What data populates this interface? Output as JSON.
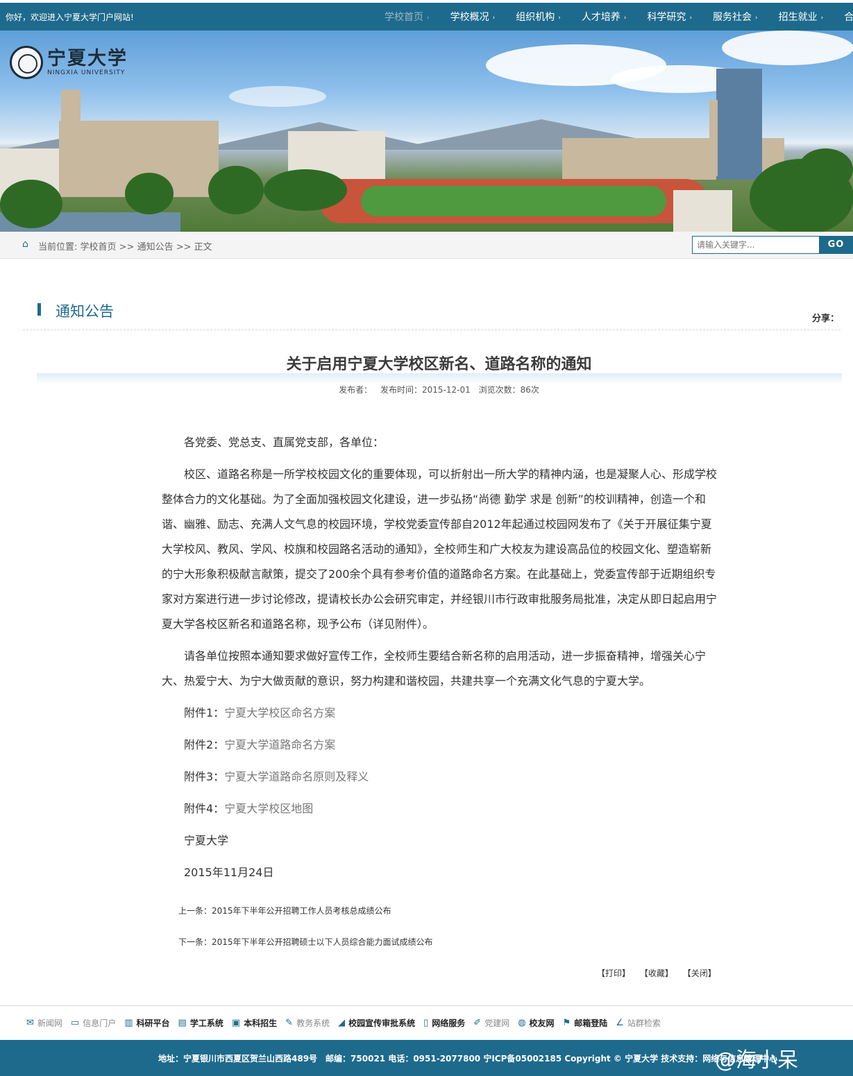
{
  "topbar": {
    "welcome": "你好，欢迎进入宁夏大学门户网站!",
    "nav": [
      {
        "label": "学校首页"
      },
      {
        "label": "学校概况"
      },
      {
        "label": "组织机构"
      },
      {
        "label": "人才培养"
      },
      {
        "label": "科学研究"
      },
      {
        "label": "服务社会"
      },
      {
        "label": "招生就业"
      },
      {
        "label": "合作交流"
      }
    ]
  },
  "logo": {
    "cn": "宁夏大学",
    "en": "NINGXIA UNIVERSITY"
  },
  "breadcrumb": {
    "label": "当前位置:",
    "path": "学校首页 >> 通知公告 >> 正文"
  },
  "search": {
    "placeholder": "请输入关键字...",
    "button": "GO"
  },
  "section": {
    "title": "通知公告",
    "share": "分享："
  },
  "article": {
    "title": "关于启用宁夏大学校区新名、道路名称的通知",
    "meta": {
      "publisher": "发布者：",
      "date": "发布时间：2015-12-01",
      "views": "浏览次数：86次"
    },
    "salutation": "各党委、党总支、直属党支部，各单位：",
    "para1": "校区、道路名称是一所学校校园文化的重要体现，可以折射出一所大学的精神内涵，也是凝聚人心、形成学校整体合力的文化基础。为了全面加强校园文化建设，进一步弘扬“尚德 勤学 求是 创新”的校训精神，创造一个和谐、幽雅、励志、充满人文气息的校园环境，学校党委宣传部自2012年起通过校园网发布了《关于开展征集宁夏大学校风、教风、学风、校旗和校园路名活动的通知》，全校师生和广大校友为建设高品位的校园文化、塑造崭新的宁大形象积极献言献策，提交了200余个具有参考价值的道路命名方案。在此基础上，党委宣传部于近期组织专家对方案进行进一步讨论修改，提请校长办公会研究审定，并经银川市行政审批服务局批准，决定从即日起启用宁夏大学各校区新名和道路名称，现予公布（详见附件）。",
    "para2": "请各单位按照本通知要求做好宣传工作，全校师生要结合新名称的启用活动，进一步振奋精神，增强关心宁大、热爱宁大、为宁大做贡献的意识，努力构建和谐校园，共建共享一个充满文化气息的宁夏大学。",
    "attachments": [
      {
        "prefix": "附件1：",
        "name": "宁夏大学校区命名方案"
      },
      {
        "prefix": "附件2：",
        "name": "宁夏大学道路命名方案"
      },
      {
        "prefix": "附件3：",
        "name": "宁夏大学道路命名原则及释义"
      },
      {
        "prefix": "附件4：",
        "name": "宁夏大学校区地图"
      }
    ],
    "signature": "宁夏大学",
    "sign_date": "2015年11月24日",
    "prev": "上一条：2015年下半年公开招聘工作人员考核总成绩公布",
    "next": "下一条：2015年下半年公开招聘硕士以下人员综合能力面试成绩公布",
    "actions": [
      "【打印】",
      "【收藏】",
      "【关闭】"
    ]
  },
  "footer_links": [
    {
      "icon": "mail-icon",
      "label": "新闻网"
    },
    {
      "icon": "monitor-icon",
      "label": "信息门户"
    },
    {
      "icon": "books-icon",
      "label": "科研平台"
    },
    {
      "icon": "document-icon",
      "label": "学工系统"
    },
    {
      "icon": "screen-user-icon",
      "label": "本科招生"
    },
    {
      "icon": "edit-icon",
      "label": "教务系统"
    },
    {
      "icon": "rss-icon",
      "label": "校园宣传审批系统"
    },
    {
      "icon": "phone-icon",
      "label": "网络服务"
    },
    {
      "icon": "pen-icon",
      "label": "党建网"
    },
    {
      "icon": "globe-icon",
      "label": "校友网"
    },
    {
      "icon": "flag-icon",
      "label": "邮箱登陆"
    },
    {
      "icon": "chart-icon",
      "label": "站群检索"
    }
  ],
  "footer": {
    "address": "地址：宁夏银川市西夏区贺兰山西路489号　邮编：750021 电话：0951-2077800 宁ICP备05002185 Copyright © 宁夏大学 技术支持：网络与信息管理中心",
    "watermark": "@海小呆"
  }
}
